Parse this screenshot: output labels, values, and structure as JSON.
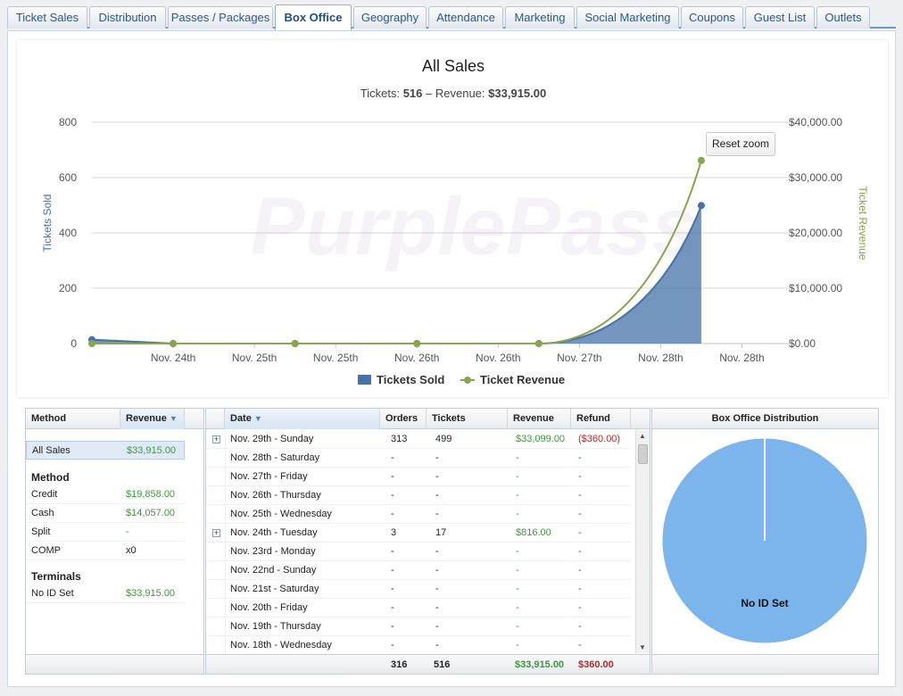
{
  "tabs": [
    {
      "label": "Ticket Sales",
      "active": false
    },
    {
      "label": "Distribution",
      "active": false
    },
    {
      "label": "Passes / Packages",
      "active": false
    },
    {
      "label": "Box Office",
      "active": true
    },
    {
      "label": "Geography",
      "active": false
    },
    {
      "label": "Attendance",
      "active": false
    },
    {
      "label": "Marketing",
      "active": false
    },
    {
      "label": "Social Marketing",
      "active": false
    },
    {
      "label": "Coupons",
      "active": false
    },
    {
      "label": "Guest List",
      "active": false
    },
    {
      "label": "Outlets",
      "active": false
    }
  ],
  "chart": {
    "reset_zoom_label": "Reset zoom",
    "watermark": "PurplePass",
    "subtitle": {
      "tickets_label": "Tickets:",
      "tickets_value": "516",
      "separator": "–",
      "revenue_label": "Revenue:",
      "revenue_value": "$33,915.00"
    }
  },
  "chart_data": {
    "type": "line",
    "title": "All Sales",
    "x_tick_labels": [
      "Nov. 24th",
      "Nov. 25th",
      "Nov. 25th",
      "Nov. 26th",
      "Nov. 26th",
      "Nov. 27th",
      "Nov. 28th",
      "Nov. 28th"
    ],
    "left_axis": {
      "label": "Tickets Sold",
      "ticks": [
        "0",
        "200",
        "400",
        "600",
        "800"
      ],
      "range": [
        0,
        800
      ]
    },
    "right_axis": {
      "label": "Ticket Revenue",
      "ticks": [
        "$0.00",
        "$10,000.00",
        "$20,000.00",
        "$30,000.00",
        "$40,000.00"
      ],
      "range": [
        0,
        40000
      ]
    },
    "x_range": [
      0,
      8.5
    ],
    "series": [
      {
        "name": "Tickets Sold",
        "kind": "area",
        "axis": "left",
        "color": "#4572a7",
        "points": [
          [
            0,
            14
          ],
          [
            1,
            0
          ],
          [
            2.5,
            0
          ],
          [
            4,
            0
          ],
          [
            5.5,
            0
          ],
          [
            7.5,
            499
          ]
        ]
      },
      {
        "name": "Ticket Revenue",
        "kind": "line",
        "axis": "right",
        "color": "#89a54e",
        "points": [
          [
            0,
            0
          ],
          [
            1,
            0
          ],
          [
            2.5,
            0
          ],
          [
            4,
            0
          ],
          [
            5.5,
            0
          ],
          [
            7.5,
            33099
          ]
        ]
      }
    ],
    "legend": {
      "position": "bottom-center"
    },
    "grid": true
  },
  "method_grid": {
    "headers": {
      "method": "Method",
      "revenue": "Revenue"
    },
    "all_sales": {
      "label": "All Sales",
      "value": "$33,915.00"
    },
    "method_title": "Method",
    "methods": [
      {
        "label": "Credit",
        "value": "$19,858.00",
        "green": true
      },
      {
        "label": "Cash",
        "value": "$14,057.00",
        "green": true
      },
      {
        "label": "Split",
        "value": "-",
        "green": true
      },
      {
        "label": "COMP",
        "value": "x0",
        "green": false
      }
    ],
    "terminals_title": "Terminals",
    "terminals": [
      {
        "label": "No ID Set",
        "value": "$33,915.00"
      }
    ]
  },
  "date_grid": {
    "headers": {
      "date": "Date",
      "orders": "Orders",
      "tickets": "Tickets",
      "revenue": "Revenue",
      "refund": "Refund"
    },
    "rows": [
      {
        "date": "Nov. 29th - Sunday",
        "orders": "313",
        "tickets": "499",
        "revenue": "$33,099.00",
        "refund": "($360.00)",
        "expand": true
      },
      {
        "date": "Nov. 28th - Saturday",
        "orders": "-",
        "tickets": "-",
        "revenue": "-",
        "refund": "-",
        "expand": false
      },
      {
        "date": "Nov. 27th - Friday",
        "orders": "-",
        "tickets": "-",
        "revenue": "-",
        "refund": "-",
        "expand": false
      },
      {
        "date": "Nov. 26th - Thursday",
        "orders": "-",
        "tickets": "-",
        "revenue": "-",
        "refund": "-",
        "expand": false
      },
      {
        "date": "Nov. 25th - Wednesday",
        "orders": "-",
        "tickets": "-",
        "revenue": "-",
        "refund": "-",
        "expand": false
      },
      {
        "date": "Nov. 24th - Tuesday",
        "orders": "3",
        "tickets": "17",
        "revenue": "$816.00",
        "refund": "-",
        "expand": true
      },
      {
        "date": "Nov. 23rd - Monday",
        "orders": "-",
        "tickets": "-",
        "revenue": "-",
        "refund": "-",
        "expand": false
      },
      {
        "date": "Nov. 22nd - Sunday",
        "orders": "-",
        "tickets": "-",
        "revenue": "-",
        "refund": "-",
        "expand": false
      },
      {
        "date": "Nov. 21st - Saturday",
        "orders": "-",
        "tickets": "-",
        "revenue": "-",
        "refund": "-",
        "expand": false
      },
      {
        "date": "Nov. 20th - Friday",
        "orders": "-",
        "tickets": "-",
        "revenue": "-",
        "refund": "-",
        "expand": false
      },
      {
        "date": "Nov. 19th - Thursday",
        "orders": "-",
        "tickets": "-",
        "revenue": "-",
        "refund": "-",
        "expand": false
      },
      {
        "date": "Nov. 18th - Wednesday",
        "orders": "-",
        "tickets": "-",
        "revenue": "-",
        "refund": "-",
        "expand": false
      }
    ],
    "totals": {
      "orders": "316",
      "tickets": "516",
      "revenue": "$33,915.00",
      "refund": "$360.00"
    }
  },
  "distribution": {
    "title": "Box Office Distribution",
    "slice_label": "No ID Set",
    "slice_color": "#7cb5ec",
    "slices": [
      {
        "label": "No ID Set",
        "value": 100
      }
    ]
  }
}
